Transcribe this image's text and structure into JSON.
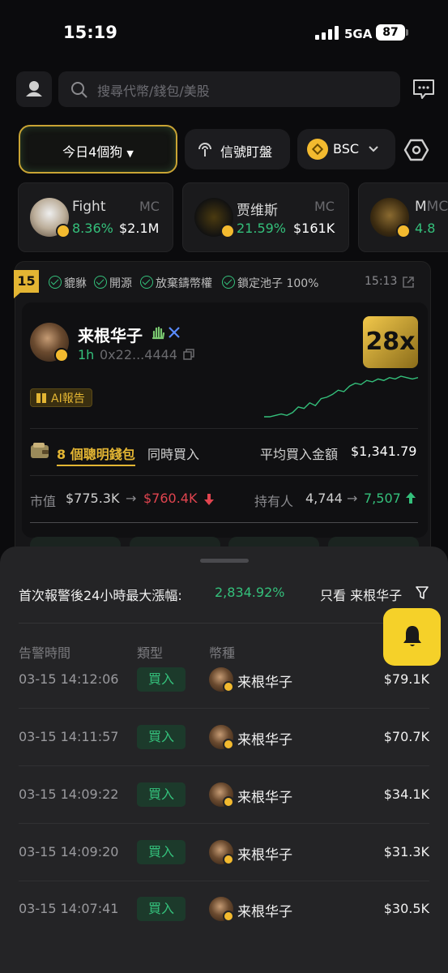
{
  "status_bar": {
    "time": "15:19",
    "network": "5GA",
    "battery": "87"
  },
  "search": {
    "placeholder": "搜尋代幣/錢包/美股"
  },
  "filters": {
    "dog_label": "今日4個狗",
    "signal_label": "信號盯盤",
    "chain_label": "BSC"
  },
  "token_cards": [
    {
      "name": "Fight",
      "mc_label": "MC",
      "change": "8.36%",
      "value": "$2.1M"
    },
    {
      "name": "贾维斯",
      "mc_label": "MC",
      "change": "21.59%",
      "value": "$161K"
    },
    {
      "name": "M",
      "mc_label": "MC",
      "change": "4.8",
      "value": ""
    }
  ],
  "signal_card": {
    "rank": "15",
    "checks": [
      "貔貅",
      "開源",
      "放棄鑄幣權",
      "鎖定池子 100%"
    ],
    "time": "15:13",
    "coin_name": "来根华子",
    "age": "1h",
    "address": "0x22...4444",
    "multiplier": "28x",
    "ai_label": "AI報告",
    "smart_count": "8 個聰明錢包",
    "smart_same": "同時買入",
    "avg_label": "平均買入金額",
    "avg_value": "$1,341.79",
    "mc_label": "市值",
    "mc_from": "$775.3K",
    "mc_to": "$760.4K",
    "holders_label": "持有人",
    "holders_from": "4,744",
    "holders_to": "7,507",
    "sparkline": [
      2,
      2,
      3,
      4,
      3,
      5,
      9,
      8,
      12,
      10,
      15,
      16,
      18,
      21,
      20,
      24,
      26,
      25,
      28,
      27,
      29,
      28,
      30,
      29,
      31,
      30,
      29,
      30
    ]
  },
  "sheet": {
    "title": "首次報警後24小時最大漲幅:",
    "max_gain": "2,834.92%",
    "only_view": "只看 来根华子",
    "columns": [
      "告警時間",
      "類型",
      "幣種"
    ],
    "rows": [
      {
        "time": "03-15 14:12:06",
        "type": "買入",
        "coin": "来根华子",
        "value": "$79.1K"
      },
      {
        "time": "03-15 14:11:57",
        "type": "買入",
        "coin": "来根华子",
        "value": "$70.7K"
      },
      {
        "time": "03-15 14:09:22",
        "type": "買入",
        "coin": "来根华子",
        "value": "$34.1K"
      },
      {
        "time": "03-15 14:09:20",
        "type": "買入",
        "coin": "来根华子",
        "value": "$31.3K"
      },
      {
        "time": "03-15 14:07:41",
        "type": "買入",
        "coin": "来根华子",
        "value": "$30.5K"
      }
    ]
  },
  "colors": {
    "accent_gold": "#e3b533",
    "up_green": "#34c07b",
    "down_red": "#e0444f",
    "bnb_yellow": "#f3ba2f",
    "bell_yellow": "#f5d129"
  },
  "icons": [
    "user-icon",
    "search-icon",
    "chat-icon",
    "caret-down-icon",
    "signal-icon",
    "bnb-icon",
    "chevron-down-icon",
    "hex-settings-icon",
    "check-icon",
    "share-icon",
    "hand-icon",
    "x-icon",
    "copy-icon",
    "book-icon",
    "wallet-icon",
    "arrow-right-icon",
    "down-arrow-icon",
    "up-arrow-icon",
    "filter-icon",
    "bell-icon"
  ]
}
